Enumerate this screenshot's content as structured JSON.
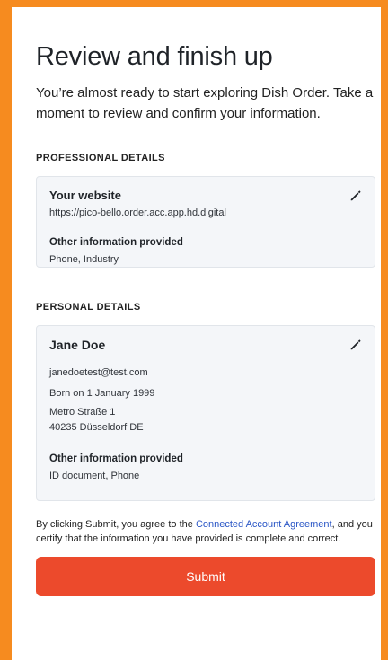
{
  "header": {
    "title": "Review and finish up",
    "intro": "You’re almost ready to start exploring Dish Order. Take a moment to review and confirm your information."
  },
  "professional": {
    "section_title": "PROFESSIONAL DETAILS",
    "website_label": "Your website",
    "website_value": "https://pico-bello.order.acc.app.hd.digital",
    "other_label": "Other information provided",
    "other_value": "Phone, Industry"
  },
  "personal": {
    "section_title": "PERSONAL DETAILS",
    "name": "Jane Doe",
    "email": "janedoetest@test.com",
    "born": "Born on 1 January 1999",
    "address_line1": "Metro Straße 1",
    "address_line2": "40235 Düsseldorf DE",
    "other_label": "Other information provided",
    "other_value": "ID document, Phone"
  },
  "legal": {
    "prefix": "By clicking Submit, you agree to the ",
    "link": "Connected Account Agreement",
    "suffix": ", and you certify that the information you have provided is complete and correct."
  },
  "actions": {
    "submit_label": "Submit"
  },
  "colors": {
    "frame": "#f68b1f",
    "submit": "#ec4a2c",
    "link": "#2a56c6",
    "card_bg": "#f4f6f9"
  },
  "icons": {
    "edit": "pencil-icon"
  }
}
